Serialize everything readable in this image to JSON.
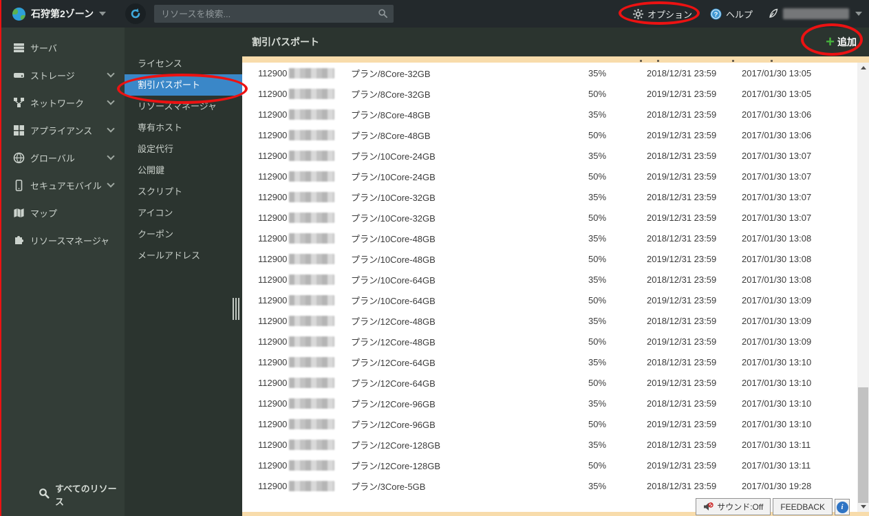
{
  "top_bar": {
    "zone_name": "石狩第2ゾーン",
    "search_placeholder": "リソースを検索...",
    "options_label": "オプション",
    "help_label": "ヘルプ",
    "account_name_redacted": true
  },
  "sidebar": {
    "items": [
      {
        "label": "サーバ",
        "icon": "server",
        "has_chevron": false
      },
      {
        "label": "ストレージ",
        "icon": "storage",
        "has_chevron": true
      },
      {
        "label": "ネットワーク",
        "icon": "network",
        "has_chevron": true
      },
      {
        "label": "アプライアンス",
        "icon": "appliance",
        "has_chevron": true
      },
      {
        "label": "グローバル",
        "icon": "global",
        "has_chevron": true
      },
      {
        "label": "セキュアモバイル",
        "icon": "mobile",
        "has_chevron": true
      },
      {
        "label": "マップ",
        "icon": "map",
        "has_chevron": false
      },
      {
        "label": "リソースマネージャ",
        "icon": "puzzle",
        "has_chevron": false
      }
    ],
    "footer_label": "すべてのリソース"
  },
  "subsidebar": {
    "items": [
      {
        "label": "ライセンス",
        "selected": false
      },
      {
        "label": "割引パスポート",
        "selected": true
      },
      {
        "label": "リソースマネージャ",
        "selected": false
      },
      {
        "label": "専有ホスト",
        "selected": false
      },
      {
        "label": "設定代行",
        "selected": false
      },
      {
        "label": "公開鍵",
        "selected": false
      },
      {
        "label": "スクリプト",
        "selected": false
      },
      {
        "label": "アイコン",
        "selected": false
      },
      {
        "label": "クーポン",
        "selected": false
      },
      {
        "label": "メールアドレス",
        "selected": false
      }
    ]
  },
  "main": {
    "title": "割引パスポート",
    "add_button_label": "追加",
    "add_button_plus": "+",
    "table": {
      "rows": [
        {
          "id": "112900",
          "plan": "プラン/8Core-32GB",
          "discount": "35%",
          "expires": "2018/12/31 23:59",
          "created": "2017/01/30 13:05"
        },
        {
          "id": "112900",
          "plan": "プラン/8Core-32GB",
          "discount": "50%",
          "expires": "2019/12/31 23:59",
          "created": "2017/01/30 13:05"
        },
        {
          "id": "112900",
          "plan": "プラン/8Core-48GB",
          "discount": "35%",
          "expires": "2018/12/31 23:59",
          "created": "2017/01/30 13:06"
        },
        {
          "id": "112900",
          "plan": "プラン/8Core-48GB",
          "discount": "50%",
          "expires": "2019/12/31 23:59",
          "created": "2017/01/30 13:06"
        },
        {
          "id": "112900",
          "plan": "プラン/10Core-24GB",
          "discount": "35%",
          "expires": "2018/12/31 23:59",
          "created": "2017/01/30 13:07"
        },
        {
          "id": "112900",
          "plan": "プラン/10Core-24GB",
          "discount": "50%",
          "expires": "2019/12/31 23:59",
          "created": "2017/01/30 13:07"
        },
        {
          "id": "112900",
          "plan": "プラン/10Core-32GB",
          "discount": "35%",
          "expires": "2018/12/31 23:59",
          "created": "2017/01/30 13:07"
        },
        {
          "id": "112900",
          "plan": "プラン/10Core-32GB",
          "discount": "50%",
          "expires": "2019/12/31 23:59",
          "created": "2017/01/30 13:07"
        },
        {
          "id": "112900",
          "plan": "プラン/10Core-48GB",
          "discount": "35%",
          "expires": "2018/12/31 23:59",
          "created": "2017/01/30 13:08"
        },
        {
          "id": "112900",
          "plan": "プラン/10Core-48GB",
          "discount": "50%",
          "expires": "2019/12/31 23:59",
          "created": "2017/01/30 13:08"
        },
        {
          "id": "112900",
          "plan": "プラン/10Core-64GB",
          "discount": "35%",
          "expires": "2018/12/31 23:59",
          "created": "2017/01/30 13:08"
        },
        {
          "id": "112900",
          "plan": "プラン/10Core-64GB",
          "discount": "50%",
          "expires": "2019/12/31 23:59",
          "created": "2017/01/30 13:09"
        },
        {
          "id": "112900",
          "plan": "プラン/12Core-48GB",
          "discount": "35%",
          "expires": "2018/12/31 23:59",
          "created": "2017/01/30 13:09"
        },
        {
          "id": "112900",
          "plan": "プラン/12Core-48GB",
          "discount": "50%",
          "expires": "2019/12/31 23:59",
          "created": "2017/01/30 13:09"
        },
        {
          "id": "112900",
          "plan": "プラン/12Core-64GB",
          "discount": "35%",
          "expires": "2018/12/31 23:59",
          "created": "2017/01/30 13:10"
        },
        {
          "id": "112900",
          "plan": "プラン/12Core-64GB",
          "discount": "50%",
          "expires": "2019/12/31 23:59",
          "created": "2017/01/30 13:10"
        },
        {
          "id": "112900",
          "plan": "プラン/12Core-96GB",
          "discount": "35%",
          "expires": "2018/12/31 23:59",
          "created": "2017/01/30 13:10"
        },
        {
          "id": "112900",
          "plan": "プラン/12Core-96GB",
          "discount": "50%",
          "expires": "2019/12/31 23:59",
          "created": "2017/01/30 13:10"
        },
        {
          "id": "112900",
          "plan": "プラン/12Core-128GB",
          "discount": "35%",
          "expires": "2018/12/31 23:59",
          "created": "2017/01/30 13:11"
        },
        {
          "id": "112900",
          "plan": "プラン/12Core-128GB",
          "discount": "50%",
          "expires": "2019/12/31 23:59",
          "created": "2017/01/30 13:11"
        },
        {
          "id": "112900",
          "plan": "プラン/3Core-5GB",
          "discount": "35%",
          "expires": "2018/12/31 23:59",
          "created": "2017/01/30 19:28"
        }
      ]
    }
  },
  "footer_widgets": {
    "sound_label": "サウンド:Off",
    "feedback_label": "FEEDBACK",
    "info_glyph": "i"
  },
  "colors": {
    "topbar_bg": "#23292c",
    "sidebar_bg": "#333d37",
    "subsidebar_bg": "#2b342f",
    "selected_blue": "#3a87c8",
    "cream_header": "#f8dcab",
    "add_green": "#46b33c",
    "annotation_red": "#ec1212"
  }
}
